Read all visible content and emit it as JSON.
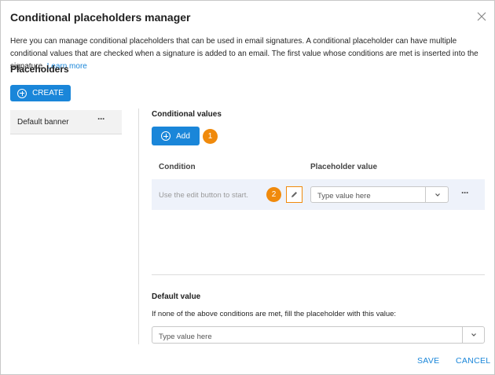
{
  "dialog": {
    "title": "Conditional placeholders manager",
    "description": "Here you can manage conditional placeholders that can be used in email signatures. A conditional placeholder can have multiple conditional values that are checked when a signature is added to an email. The first value whose conditions are met is inserted into the signature.",
    "learn_more": "Learn more",
    "close_icon": "close-icon"
  },
  "placeholders": {
    "section_title": "Placeholders",
    "create_label": "CREATE",
    "items": [
      {
        "label": "Default banner",
        "menu": "···"
      }
    ]
  },
  "conditional_values": {
    "title": "Conditional values",
    "add_label": "Add",
    "badge1": "1",
    "badge2": "2",
    "columns": {
      "condition": "Condition",
      "value": "Placeholder value"
    },
    "rows": [
      {
        "condition_hint": "Use the edit button to start.",
        "value_placeholder": "Type value here",
        "menu": "···"
      }
    ]
  },
  "default_value": {
    "title": "Default value",
    "description": "If none of the above conditions are met, fill the placeholder with this value:",
    "placeholder": "Type value here"
  },
  "footer": {
    "save_label": "SAVE",
    "cancel_label": "CANCEL"
  },
  "colors": {
    "accent": "#1a86d9",
    "badge": "#f08a0c",
    "row_bg": "#eef2fa"
  }
}
